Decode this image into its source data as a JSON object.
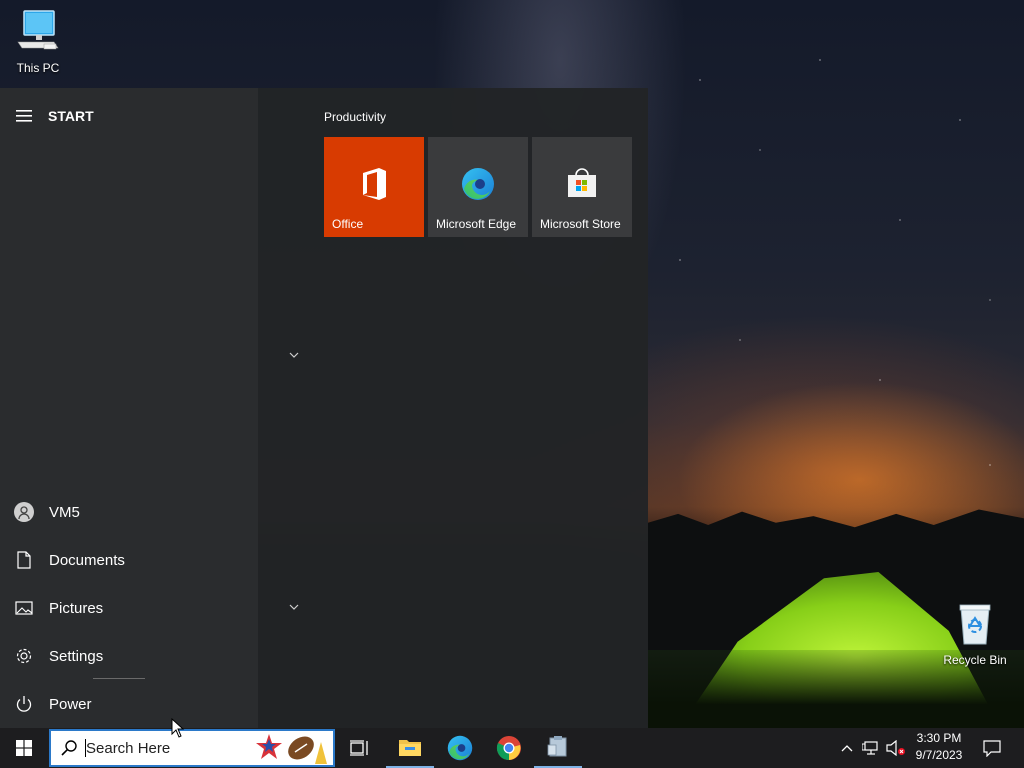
{
  "desktop": {
    "icons": [
      {
        "label": "This PC",
        "icon": "computer-icon"
      },
      {
        "label": "Recycle Bin",
        "icon": "recycle-bin-icon"
      }
    ]
  },
  "start_menu": {
    "header": "START",
    "rail": {
      "user": "VM5",
      "documents": "Documents",
      "pictures": "Pictures",
      "settings": "Settings",
      "power": "Power"
    },
    "group_title": "Productivity",
    "tiles": [
      {
        "label": "Office",
        "icon": "office-icon",
        "color": "#d83b01"
      },
      {
        "label": "Microsoft Edge",
        "icon": "edge-icon"
      },
      {
        "label": "Microsoft Store",
        "icon": "store-icon"
      }
    ]
  },
  "taskbar": {
    "search_placeholder": "Search Here",
    "apps": [
      "file-explorer-icon",
      "edge-icon",
      "chrome-icon",
      "app-icon"
    ],
    "clock": {
      "time": "3:30 PM",
      "date": "9/7/2023"
    }
  },
  "colors": {
    "accent": "#2b79c9",
    "office": "#d83b01",
    "taskbar": "#1d1d1f"
  }
}
